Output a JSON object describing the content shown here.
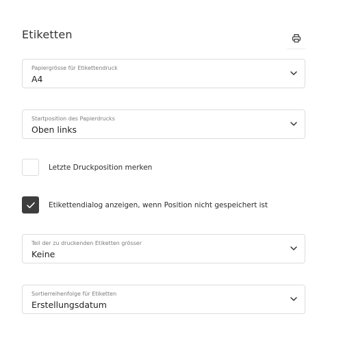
{
  "section": {
    "title": "Etiketten"
  },
  "icons": {
    "print": "printer-icon",
    "chevron": "chevron-down-icon",
    "check": "checkmark-icon"
  },
  "colors": {
    "checkbox_checked": "#3d3d3d",
    "border": "#dcdcdc"
  },
  "fields": {
    "paper_size": {
      "label": "Papiergrösse für Etikettendruck",
      "value": "A4"
    },
    "start_position": {
      "label": "Startposition des Papierdrucks",
      "value": "Oben links"
    },
    "larger_part": {
      "label": "Teil der zu druckenden Etiketten grösser",
      "value": "Keine"
    },
    "sort_order": {
      "label": "Sortierreihenfolge für Etiketten",
      "value": "Erstellungsdatum"
    }
  },
  "checkboxes": {
    "remember_position": {
      "label": "Letzte Druckposition merken",
      "checked": false
    },
    "show_dialog": {
      "label": "Etikettendialog anzeigen, wenn Position nicht gespeichert ist",
      "checked": true
    }
  }
}
